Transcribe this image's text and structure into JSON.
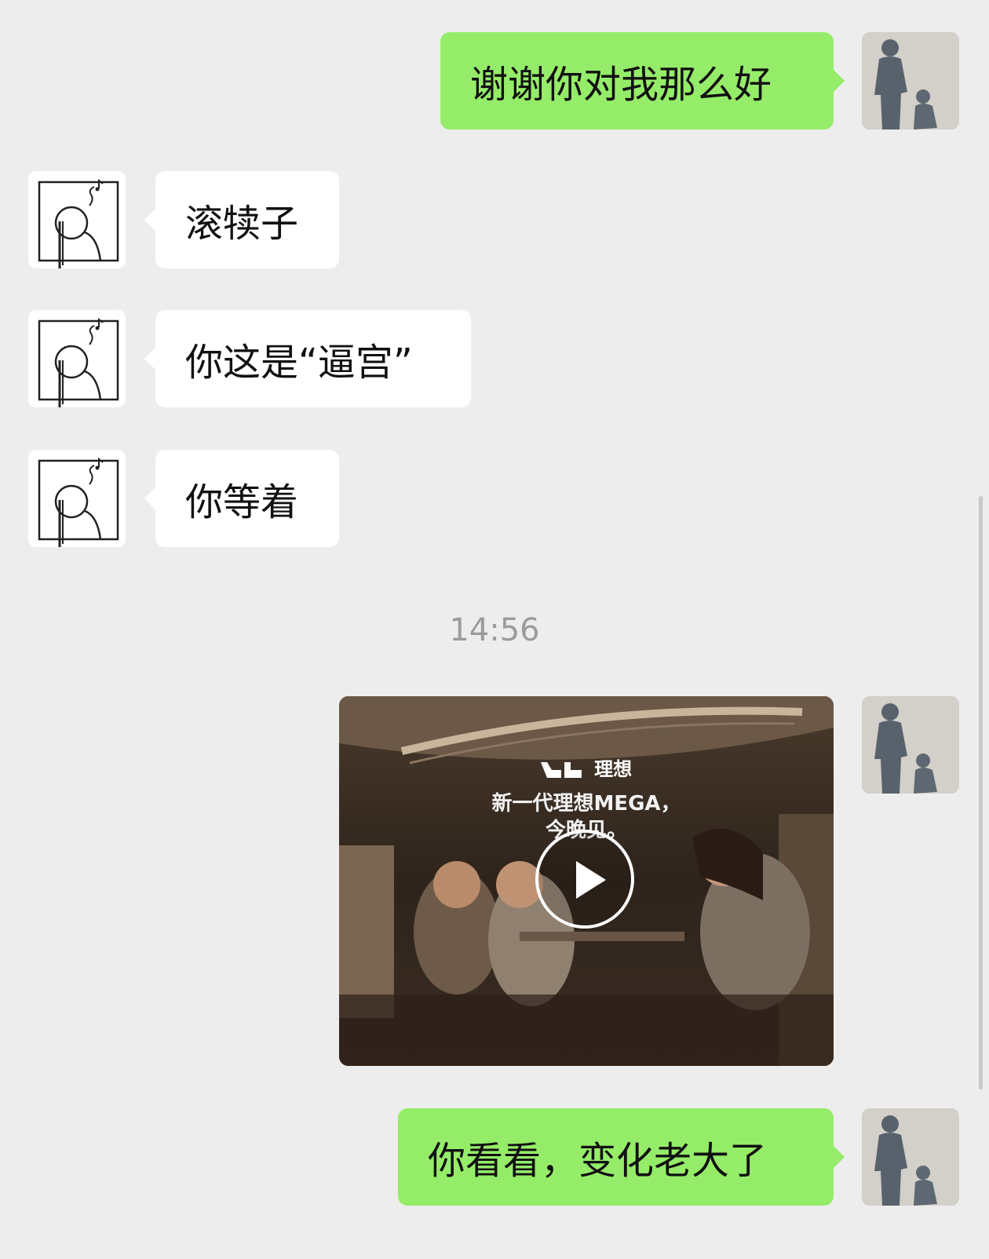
{
  "messages": [
    {
      "sender": "me",
      "text": "谢谢你对我那么好"
    },
    {
      "sender": "other",
      "text": "滚犊子"
    },
    {
      "sender": "other",
      "text": "你这是“逼宫”"
    },
    {
      "sender": "other",
      "text": "你等着"
    },
    {
      "sender": "me",
      "text": "你看看，变化老大了"
    }
  ],
  "timestamp": "14:56",
  "video": {
    "brand": "理想",
    "headline_line1": "新一代理想MEGA，",
    "headline_line2": "今晚见。"
  },
  "colors": {
    "background": "#ededed",
    "outgoing_bubble": "#95ec69",
    "incoming_bubble": "#ffffff",
    "timestamp_text": "#9b9b9b"
  }
}
